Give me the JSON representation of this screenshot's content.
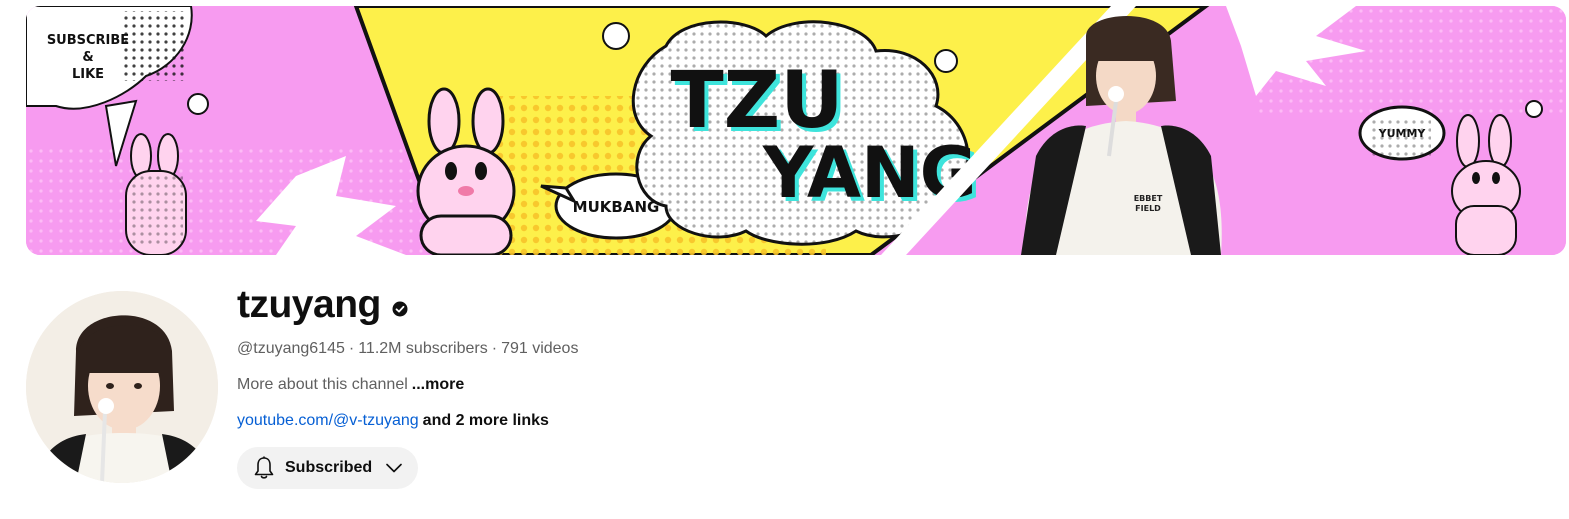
{
  "banner": {
    "title_line1": "TZU",
    "title_line2": "YANG",
    "bubble_left": [
      "SUBSCRIBE",
      "&",
      "LIKE"
    ],
    "bubble_mukbang": "MUKBANG",
    "bubble_yummy": "YUMMY",
    "shirt_text": [
      "EBBET",
      "FIELD"
    ],
    "colors": {
      "pink": "#f79bf0",
      "yellow": "#fdf04a",
      "black": "#111111",
      "cyan": "#3ee4dc"
    }
  },
  "channel": {
    "name": "tzuyang",
    "verified_icon": "verified-check-icon",
    "handle": "@tzuyang6145",
    "separator": "·",
    "subscribers": "11.2M subscribers",
    "videos": "791 videos",
    "about_text": "More about this channel",
    "about_more": "...more",
    "link_text": "youtube.com/@v-tzuyang",
    "more_links": "and 2 more links"
  },
  "subscribe_button": {
    "label": "Subscribed",
    "icon": "bell-icon",
    "dropdown_icon": "chevron-down-icon",
    "background": "#f2f2f2"
  }
}
